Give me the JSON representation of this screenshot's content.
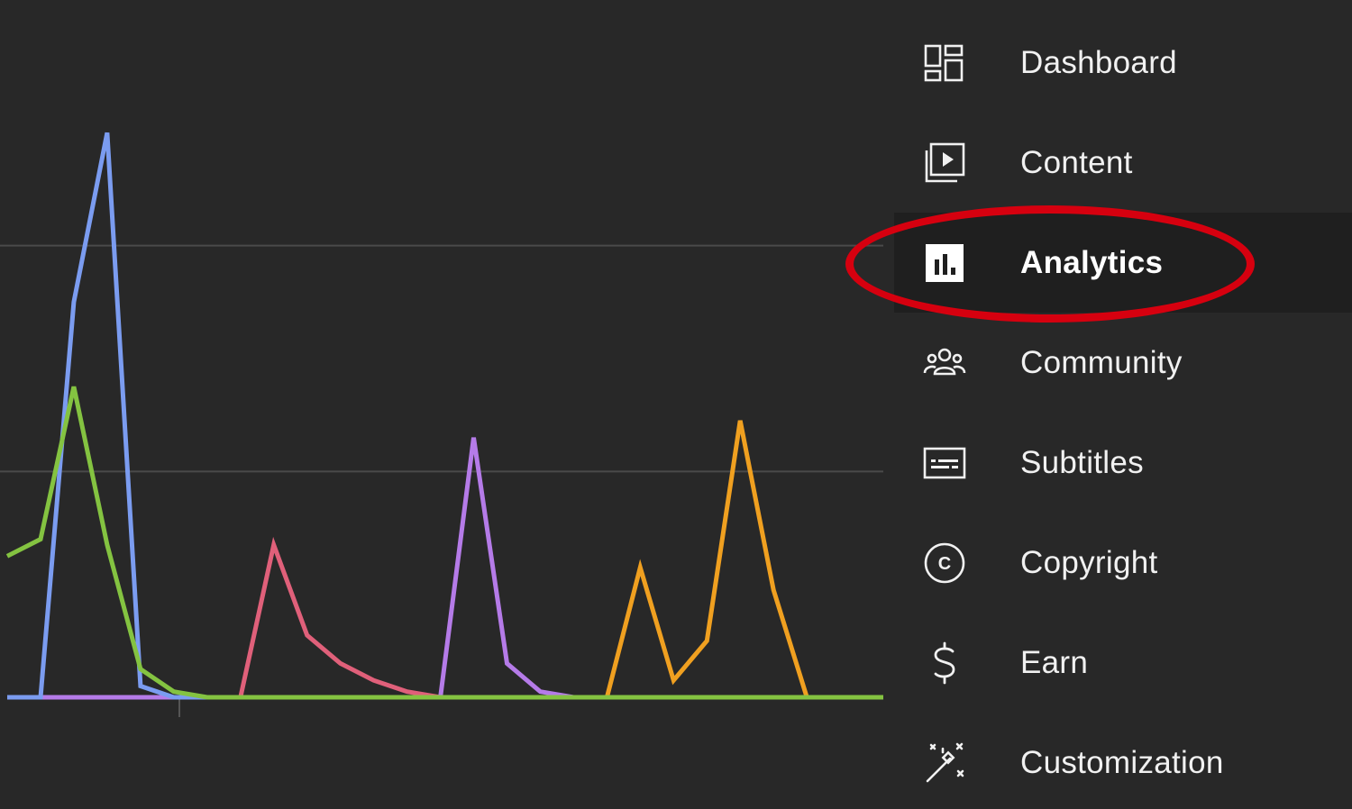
{
  "sidebar": {
    "items": [
      {
        "label": "Dashboard",
        "icon": "dashboard-icon"
      },
      {
        "label": "Content",
        "icon": "content-icon"
      },
      {
        "label": "Analytics",
        "icon": "analytics-icon",
        "active": true
      },
      {
        "label": "Community",
        "icon": "community-icon"
      },
      {
        "label": "Subtitles",
        "icon": "subtitles-icon"
      },
      {
        "label": "Copyright",
        "icon": "copyright-icon"
      },
      {
        "label": "Earn",
        "icon": "earn-icon"
      },
      {
        "label": "Customization",
        "icon": "customization-icon"
      }
    ]
  },
  "highlight": {
    "color": "#d6000f",
    "target": "Analytics"
  },
  "colors": {
    "background": "#282828",
    "active_background": "#1f1f1f",
    "text": "#f1f1f1",
    "gridline": "#4a4a4a"
  },
  "chart_data": {
    "type": "line",
    "title": "",
    "xlabel": "",
    "ylabel": "",
    "x": [
      0,
      1,
      2,
      3,
      4,
      5,
      6,
      7,
      8,
      9,
      10,
      11,
      12,
      13,
      14,
      15,
      16,
      17,
      18,
      19,
      20,
      21,
      22,
      23,
      24,
      25,
      26,
      27,
      28,
      29
    ],
    "ylim": [
      0,
      1.2
    ],
    "grid": true,
    "series": [
      {
        "color": "#7b9cf0",
        "values": [
          0,
          0,
          0.7,
          1.0,
          0.02,
          0,
          0,
          0,
          0,
          0,
          0,
          0,
          0,
          0,
          0,
          0,
          0,
          0,
          0,
          0,
          0,
          0,
          0,
          0,
          0,
          0,
          0,
          0,
          0,
          0
        ]
      },
      {
        "color": "#84c341",
        "values": [
          0.25,
          0.28,
          0.55,
          0.27,
          0.05,
          0.01,
          0,
          0,
          0,
          0,
          0,
          0,
          0,
          0,
          0,
          0,
          0,
          0,
          0,
          0,
          0,
          0,
          0,
          0,
          0,
          0,
          0,
          0,
          0,
          0
        ]
      },
      {
        "color": "#e0607a",
        "values": [
          0,
          0,
          0,
          0,
          0,
          0,
          0,
          0,
          0.27,
          0.11,
          0.06,
          0.03,
          0.01,
          0,
          0,
          0,
          0,
          0,
          0,
          0,
          0,
          0,
          0,
          0,
          0,
          0,
          0,
          0,
          0,
          0
        ]
      },
      {
        "color": "#b57be8",
        "values": [
          0,
          0,
          0,
          0,
          0,
          0,
          0,
          0,
          0,
          0,
          0,
          0,
          0,
          0,
          0.46,
          0.06,
          0.01,
          0,
          0,
          0,
          0,
          0,
          0,
          0,
          0,
          0,
          0,
          0,
          0,
          0
        ]
      },
      {
        "color": "#f0a020",
        "values": [
          0,
          0,
          0,
          0,
          0,
          0,
          0,
          0,
          0,
          0,
          0,
          0,
          0,
          0,
          0,
          0,
          0,
          0,
          0,
          0.23,
          0.03,
          0.1,
          0.49,
          0.19,
          0,
          0,
          0,
          0,
          0,
          0
        ]
      }
    ]
  }
}
